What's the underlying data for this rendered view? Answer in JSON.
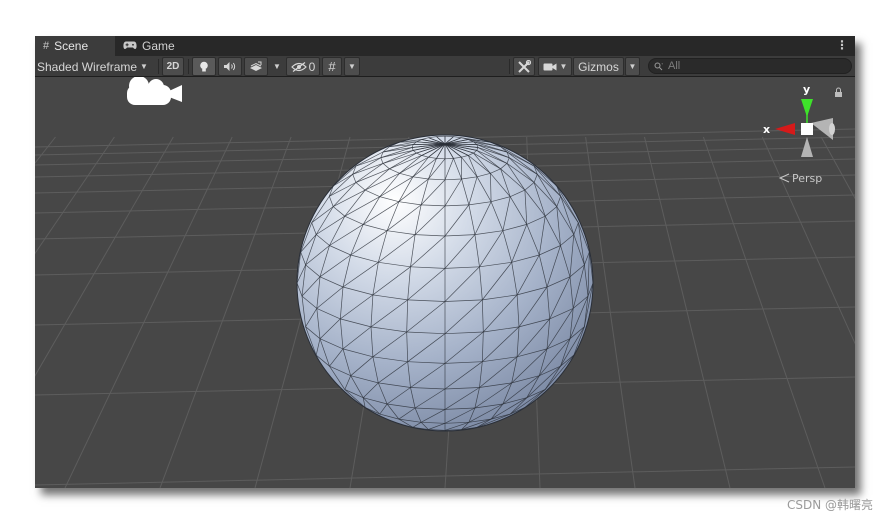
{
  "tabs": [
    {
      "label": "Scene",
      "icon": "hash-grid-icon",
      "active": true
    },
    {
      "label": "Game",
      "icon": "gamepad-icon",
      "active": false
    }
  ],
  "toolbar": {
    "draw_mode": "Shaded Wireframe",
    "mode_2d": "2D",
    "hidden_count": "0",
    "gizmos_label": "Gizmos",
    "search_placeholder": "All"
  },
  "orientation_gizmo": {
    "y_label": "y",
    "x_label": "x",
    "projection_label": "Persp",
    "colors": {
      "x": "#d61a1a",
      "y": "#3ee22a",
      "neutral": "#b4b4b4"
    }
  },
  "watermark": "CSDN @韩曙亮",
  "colors": {
    "viewport_bg": "#474747",
    "tabbar_bg": "#282828",
    "toolbar_bg": "#3c3c3c",
    "grid_line": "#5d5d5d",
    "sphere_light": "#ffffff",
    "sphere_mid": "#b6c2d6",
    "sphere_dark": "#7c8aa6",
    "wire": "#2a2f38"
  }
}
